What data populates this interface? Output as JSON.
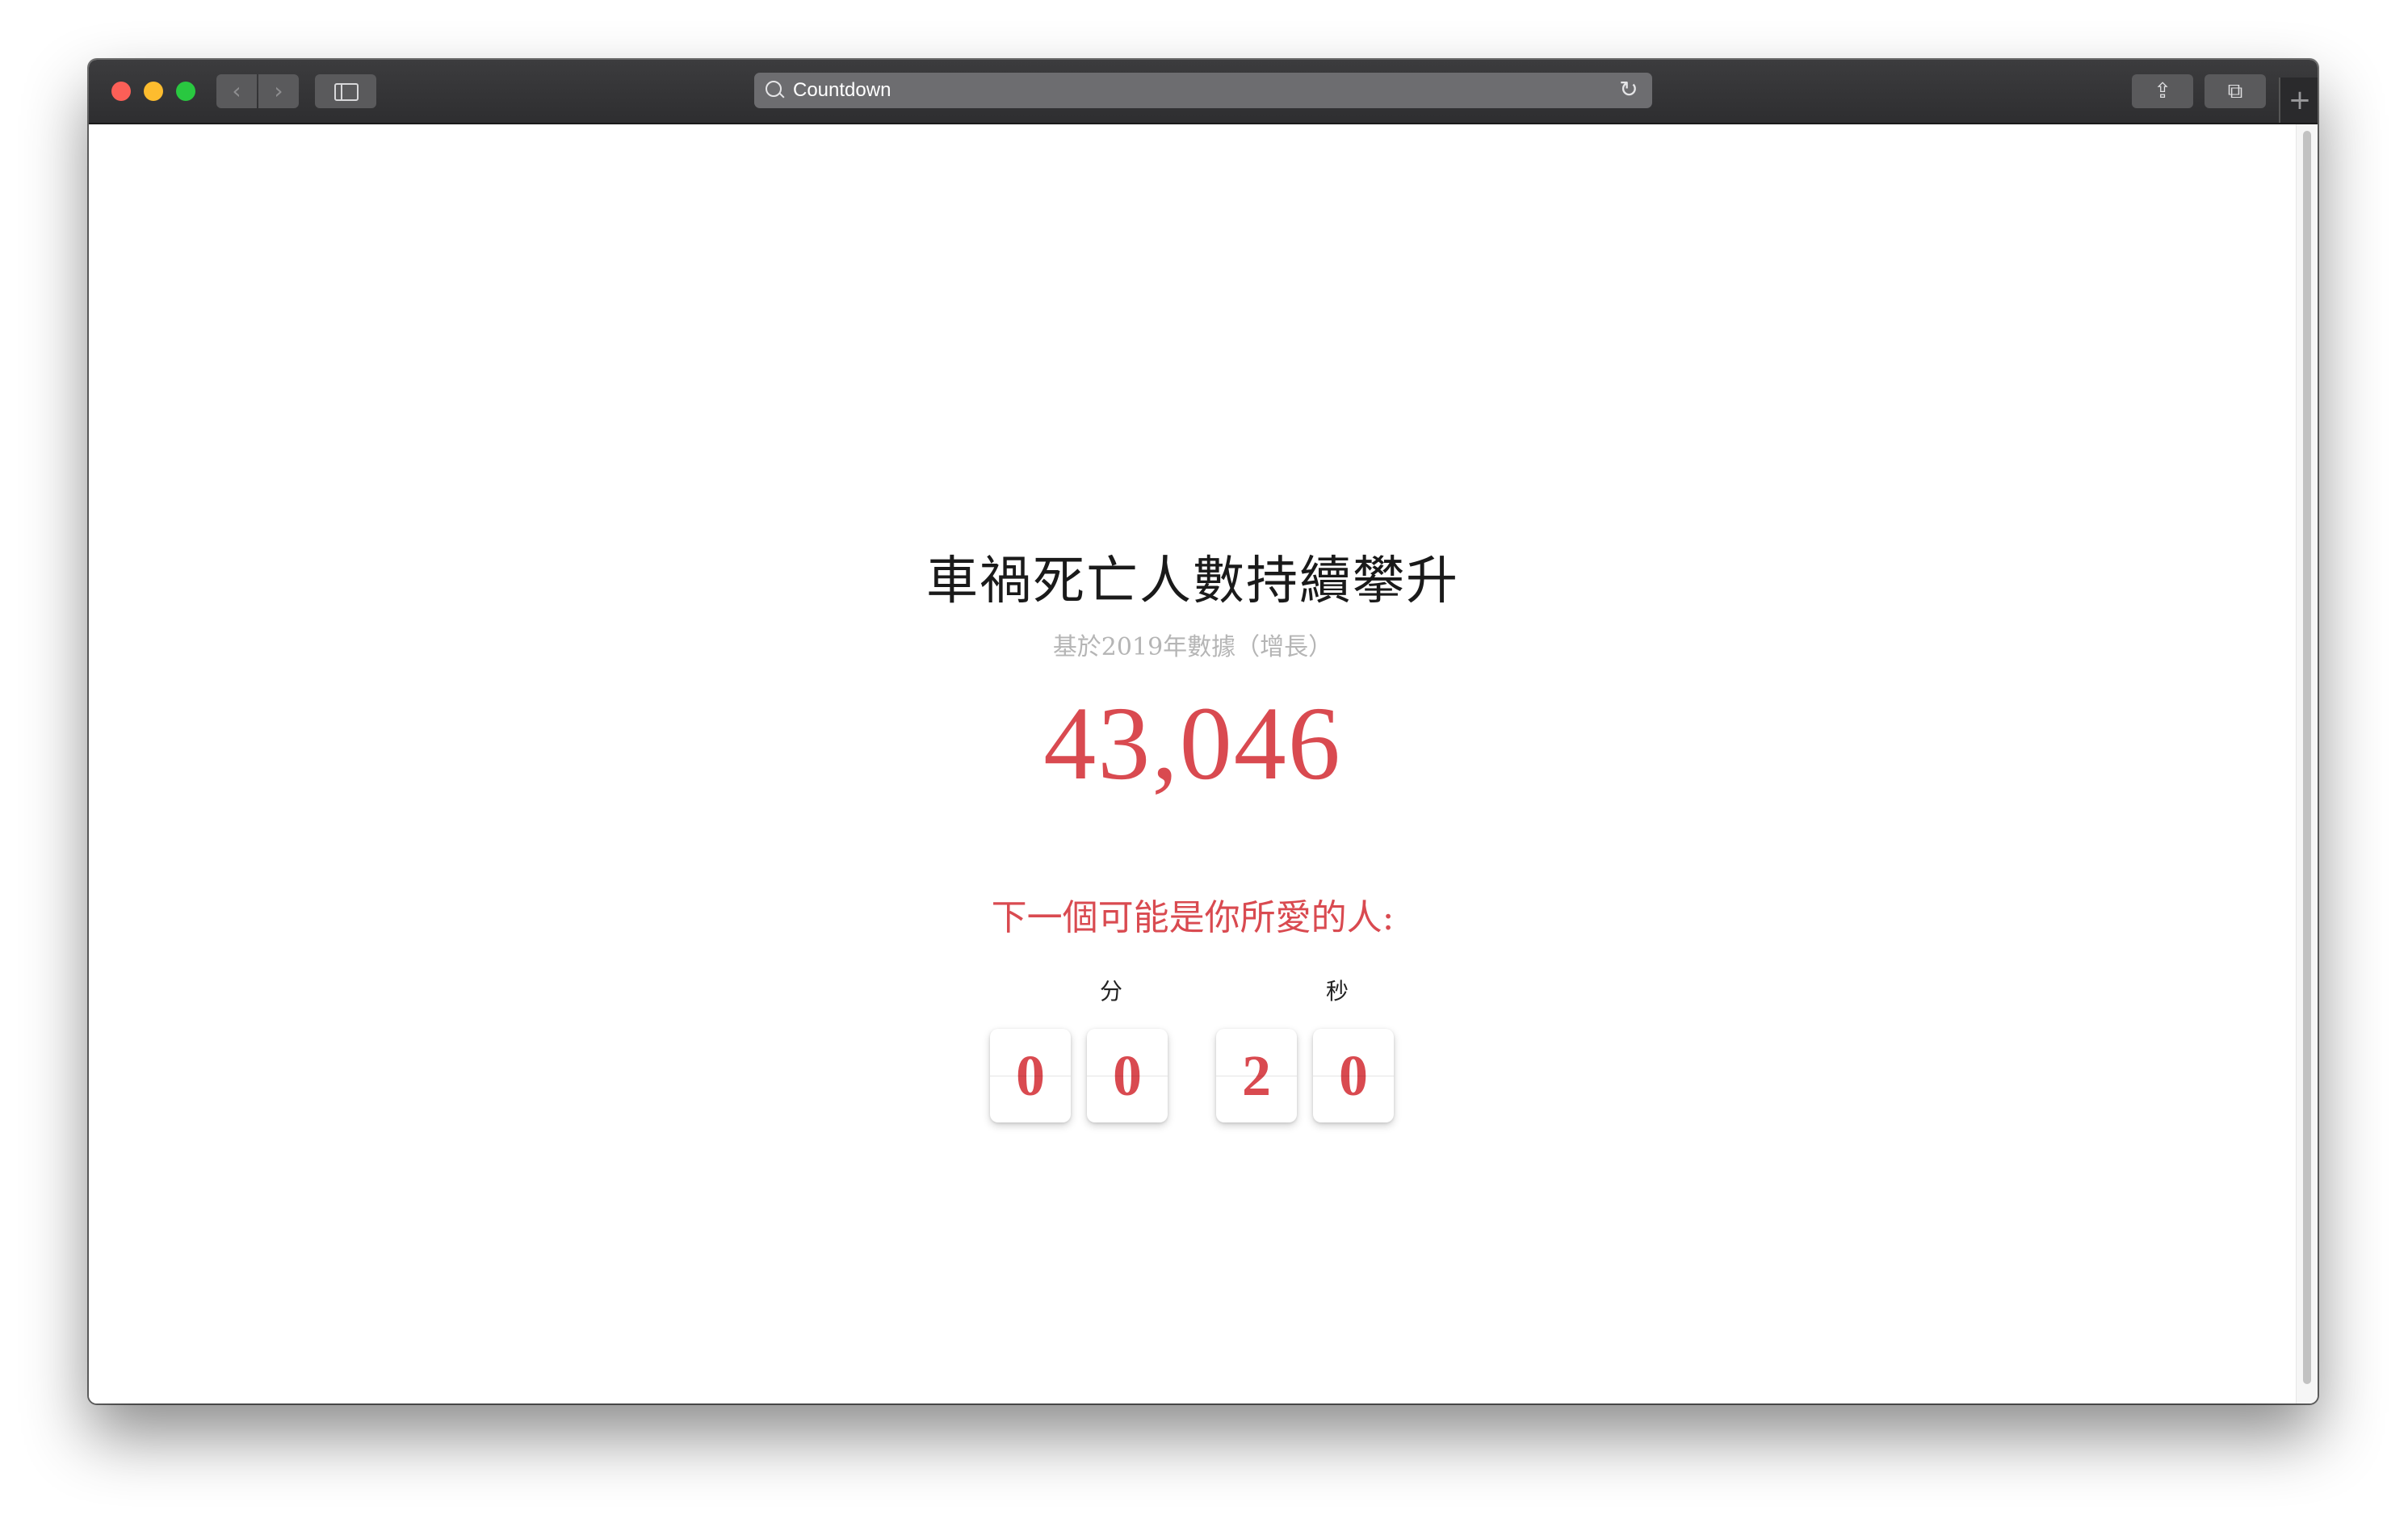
{
  "browser": {
    "address_bar_text": "Countdown",
    "reload_icon": "reload-icon",
    "share_icon": "share-icon",
    "tabs_icon": "tabs-overview-icon",
    "new_tab_icon": "plus-icon",
    "back_icon": "chevron-left-icon",
    "forward_icon": "chevron-right-icon",
    "sidebar_icon": "sidebar-icon",
    "search_icon": "search-icon"
  },
  "page": {
    "title": "車禍死亡人數持續攀升",
    "subtitle": "基於2019年數據（增長）",
    "count": "43,046",
    "next_line": "下一個可能是你所愛的人:",
    "minutes_label": "分",
    "seconds_label": "秒",
    "minutes_digits": [
      "0",
      "0"
    ],
    "seconds_digits": [
      "2",
      "0"
    ]
  },
  "colors": {
    "accent_red": "#d94a50",
    "subtitle_gray": "#b5b5b5",
    "titlebar": "#3c3c3e"
  }
}
